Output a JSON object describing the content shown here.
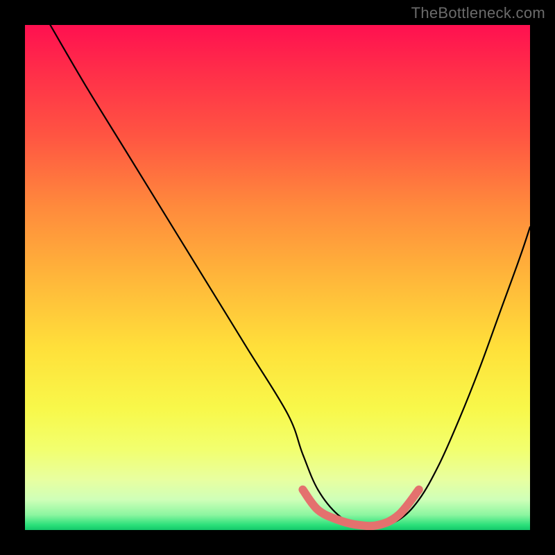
{
  "watermark": "TheBottleneck.com",
  "chart_data": {
    "type": "line",
    "title": "",
    "xlabel": "",
    "ylabel": "",
    "xlim": [
      0,
      100
    ],
    "ylim": [
      0,
      100
    ],
    "series": [
      {
        "name": "bottleneck-curve",
        "x": [
          5,
          12,
          20,
          28,
          36,
          44,
          52,
          55,
          58,
          62,
          66,
          70,
          74,
          78,
          82,
          86,
          90,
          94,
          98,
          100
        ],
        "values": [
          100,
          88,
          75,
          62,
          49,
          36,
          23,
          15,
          8,
          3,
          1,
          1,
          2,
          6,
          13,
          22,
          32,
          43,
          54,
          60
        ]
      },
      {
        "name": "highlight-band",
        "x": [
          55,
          58,
          62,
          66,
          70,
          74,
          78
        ],
        "values": [
          8,
          4,
          2,
          1,
          1,
          3,
          8
        ]
      }
    ],
    "gradient_stops": [
      {
        "pos": 0.0,
        "color": "#ff1050"
      },
      {
        "pos": 0.08,
        "color": "#ff2a4a"
      },
      {
        "pos": 0.22,
        "color": "#ff5542"
      },
      {
        "pos": 0.36,
        "color": "#ff8a3c"
      },
      {
        "pos": 0.5,
        "color": "#ffb63a"
      },
      {
        "pos": 0.64,
        "color": "#ffe03a"
      },
      {
        "pos": 0.76,
        "color": "#f8f84a"
      },
      {
        "pos": 0.84,
        "color": "#f2ff6e"
      },
      {
        "pos": 0.9,
        "color": "#e8ffa0"
      },
      {
        "pos": 0.94,
        "color": "#cfffb8"
      },
      {
        "pos": 0.97,
        "color": "#8cf6a0"
      },
      {
        "pos": 0.99,
        "color": "#2be07a"
      },
      {
        "pos": 1.0,
        "color": "#14c86a"
      }
    ],
    "colors": {
      "curve": "#000000",
      "highlight": "#e4716e",
      "background_frame": "#000000"
    }
  }
}
